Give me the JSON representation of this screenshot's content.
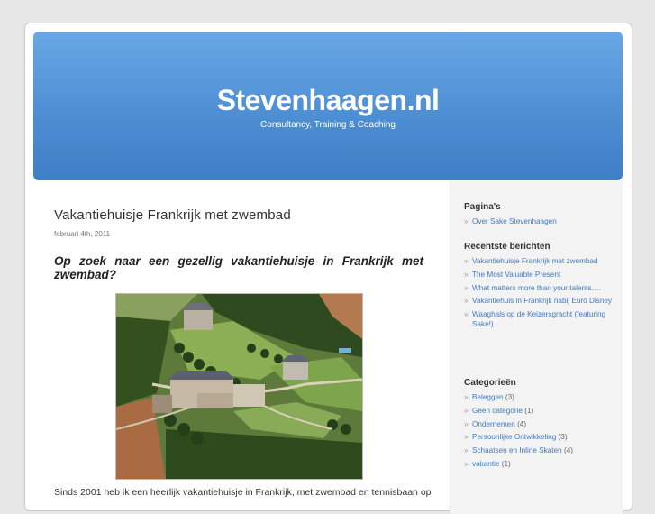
{
  "header": {
    "site_title": "Stevenhaagen.nl",
    "site_description": "Consultancy, Training & Coaching"
  },
  "post": {
    "title": "Vakantiehuisje Frankrijk met zwembad",
    "date": "februari 4th, 2011",
    "subheading_line1": "Op zoek naar een gezellig vakantiehuisje in Frankrijk met",
    "subheading_line2": "zwembad?",
    "body_preview": "Sinds 2001 heb ik een heerlijk vakantiehuisje in Frankrijk, met zwembad en tennisbaan op"
  },
  "sidebar": {
    "bullet": "»",
    "pages": {
      "heading": "Pagina's",
      "items": [
        {
          "label": "Over Sake Stevenhaagen"
        }
      ]
    },
    "recent": {
      "heading": "Recentste berichten",
      "items": [
        {
          "label": "Vakantiehuisje Frankrijk met zwembad"
        },
        {
          "label": "The Most Valuable Present"
        },
        {
          "label": "What matters more than your talents…."
        },
        {
          "label": "Vakantiehuis in Frankrijk nabij Euro Disney"
        },
        {
          "label": "Waaghals op de Keizersgracht (featuring Sake!)"
        }
      ]
    },
    "categories": {
      "heading": "Categorieën",
      "items": [
        {
          "label": "Beleggen",
          "count": "(3)"
        },
        {
          "label": "Geen categorie",
          "count": "(1)"
        },
        {
          "label": "Ondernemen",
          "count": "(4)"
        },
        {
          "label": "Persoonlijke Ontwikkeling",
          "count": "(3)"
        },
        {
          "label": "Schaatsen en Inline Skaten",
          "count": "(4)"
        },
        {
          "label": "vakantie",
          "count": "(1)"
        }
      ]
    }
  },
  "colors": {
    "header_blue": "#4e8fd4",
    "link_blue": "#3f79c3",
    "sidebar_bg": "#f3f3f3"
  }
}
